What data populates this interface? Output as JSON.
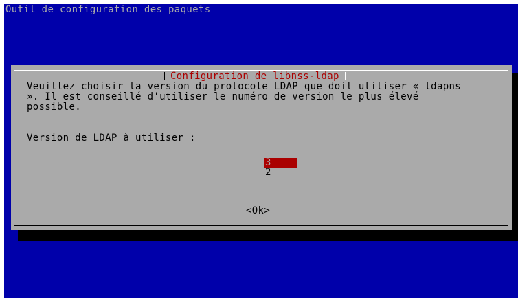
{
  "backtitle": "Outil de configuration des paquets",
  "dialog": {
    "title": "Configuration de libnss-ldap",
    "description_lines": [
      "Veuillez choisir la version du protocole LDAP que doit utiliser « ldapns",
      "». Il est conseillé d'utiliser le numéro de version le plus élevé",
      "possible."
    ],
    "prompt": "Version de LDAP à utiliser :",
    "options": [
      "3",
      "2"
    ],
    "selected_option": "3",
    "ok_button": "<Ok>"
  },
  "colors": {
    "background": "#0000aa",
    "dialog": "#aaaaaa",
    "title": "#aa0000",
    "selection": "#aa0000",
    "shadow": "#000000"
  }
}
